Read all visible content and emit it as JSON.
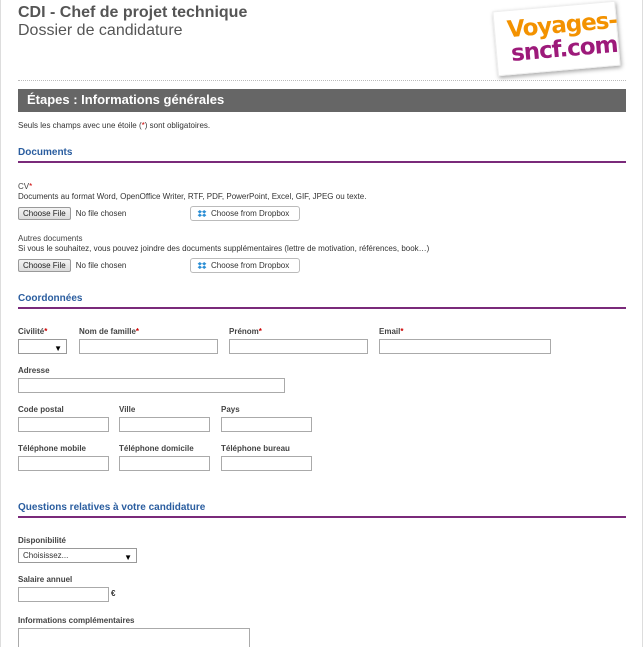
{
  "header": {
    "title": "CDI - Chef de projet technique",
    "subtitle": "Dossier de candidature",
    "logo_line1": "Voyages-",
    "logo_line2": "sncf.com"
  },
  "step_bar": {
    "label": "Étapes : Informations générales"
  },
  "required_note": {
    "before": "Seuls les champs avec une étoile (",
    "star": "*",
    "after": ") sont obligatoires."
  },
  "documents": {
    "title": "Documents",
    "cv_label": "CV",
    "cv_star": "*",
    "cv_help": "Documents au format Word, OpenOffice Writer, RTF, PDF, PowerPoint, Excel, GIF, JPEG ou texte.",
    "choose_file": "Choose File",
    "no_file": "No file chosen",
    "dropbox": "Choose from Dropbox",
    "other_label": "Autres documents",
    "other_help": "Si vous le souhaitez, vous pouvez joindre des documents supplémentaires (lettre de motivation, références, book…)"
  },
  "coordonnees": {
    "title": "Coordonnées",
    "civilite": "Civilité",
    "nom": "Nom de famille",
    "prenom": "Prénom",
    "email": "Email",
    "star": "*",
    "adresse": "Adresse",
    "code_postal": "Code postal",
    "ville": "Ville",
    "pays": "Pays",
    "tel_mobile": "Téléphone mobile",
    "tel_domicile": "Téléphone domicile",
    "tel_bureau": "Téléphone bureau"
  },
  "questions": {
    "title": "Questions relatives à votre candidature",
    "disponibilite": "Disponibilité",
    "disponibilite_value": "Choisissez...",
    "salaire": "Salaire annuel",
    "currency": "€",
    "infos": "Informations complémentaires"
  },
  "colors": {
    "section_title": "#2a5d9f",
    "rule": "#7a2a7a",
    "step_bar": "#666666",
    "required": "#cc0000"
  }
}
